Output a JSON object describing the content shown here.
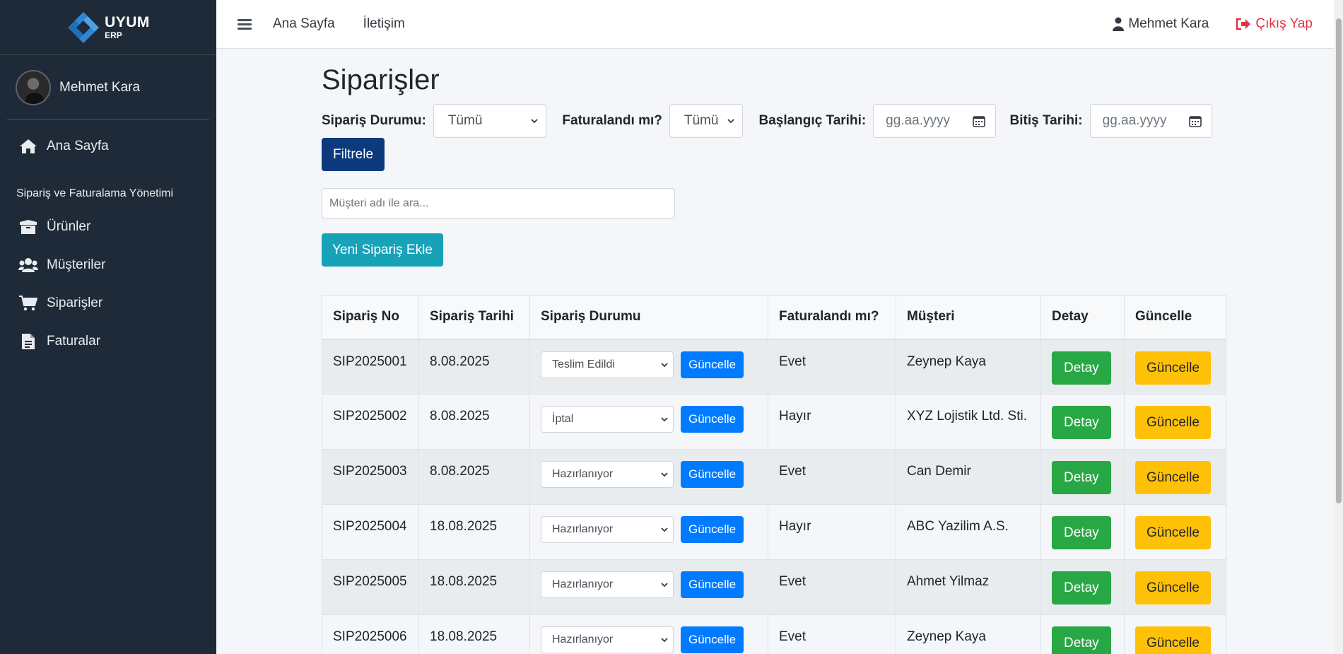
{
  "brand": {
    "name": "UYUM",
    "sub": "ERP"
  },
  "sidebar": {
    "user": "Mehmet Kara",
    "home": "Ana Sayfa",
    "section": "Sipariş ve Faturalama Yönetimi",
    "items": [
      {
        "label": "Ürünler",
        "icon": "box-icon"
      },
      {
        "label": "Müşteriler",
        "icon": "users-icon"
      },
      {
        "label": "Siparişler",
        "icon": "cart-icon"
      },
      {
        "label": "Faturalar",
        "icon": "document-icon"
      }
    ]
  },
  "topbar": {
    "links": [
      "Ana Sayfa",
      "İletişim"
    ],
    "user": "Mehmet Kara",
    "logout": "Çıkış Yap"
  },
  "page": {
    "title": "Siparişler",
    "filters": {
      "status_label": "Sipariş Durumu:",
      "status_value": "Tümü",
      "invoiced_label": "Faturalandı mı?",
      "invoiced_value": "Tümü",
      "start_label": "Başlangıç Tarihi:",
      "start_placeholder": "gg.aa.yyyy",
      "end_label": "Bitiş Tarihi:",
      "end_placeholder": "gg.aa.yyyy",
      "filter_button": "Filtrele"
    },
    "search_placeholder": "Müşteri adı ile ara...",
    "new_order_button": "Yeni Sipariş Ekle"
  },
  "table": {
    "headers": [
      "Sipariş No",
      "Sipariş Tarihi",
      "Sipariş Durumu",
      "Faturalandı mı?",
      "Müşteri",
      "Detay",
      "Güncelle"
    ],
    "rows": [
      {
        "no": "SIP2025001",
        "date": "8.08.2025",
        "status": "Teslim Edildi",
        "update": "Güncelle",
        "invoiced": "Evet",
        "customer": "Zeynep Kaya",
        "detail": "Detay",
        "edit": "Güncelle"
      },
      {
        "no": "SIP2025002",
        "date": "8.08.2025",
        "status": "İptal",
        "update": "Güncelle",
        "invoiced": "Hayır",
        "customer": "XYZ Lojistik Ltd. Sti.",
        "detail": "Detay",
        "edit": "Güncelle"
      },
      {
        "no": "SIP2025003",
        "date": "8.08.2025",
        "status": "Hazırlanıyor",
        "update": "Güncelle",
        "invoiced": "Evet",
        "customer": "Can Demir",
        "detail": "Detay",
        "edit": "Güncelle"
      },
      {
        "no": "SIP2025004",
        "date": "18.08.2025",
        "status": "Hazırlanıyor",
        "update": "Güncelle",
        "invoiced": "Hayır",
        "customer": "ABC Yazilim A.S.",
        "detail": "Detay",
        "edit": "Güncelle"
      },
      {
        "no": "SIP2025005",
        "date": "18.08.2025",
        "status": "Hazırlanıyor",
        "update": "Güncelle",
        "invoiced": "Evet",
        "customer": "Ahmet Yilmaz",
        "detail": "Detay",
        "edit": "Güncelle"
      },
      {
        "no": "SIP2025006",
        "date": "18.08.2025",
        "status": "Hazırlanıyor",
        "update": "Güncelle",
        "invoiced": "Evet",
        "customer": "Zeynep Kaya",
        "detail": "Detay",
        "edit": "Güncelle"
      }
    ]
  },
  "colors": {
    "sidebar_bg": "#1f2a38",
    "primary": "#007bff",
    "filter_button": "#0d3a7d",
    "new_button": "#17a2b8",
    "detail_button": "#28a745",
    "edit_button": "#ffc107",
    "logout": "#dc3545"
  }
}
